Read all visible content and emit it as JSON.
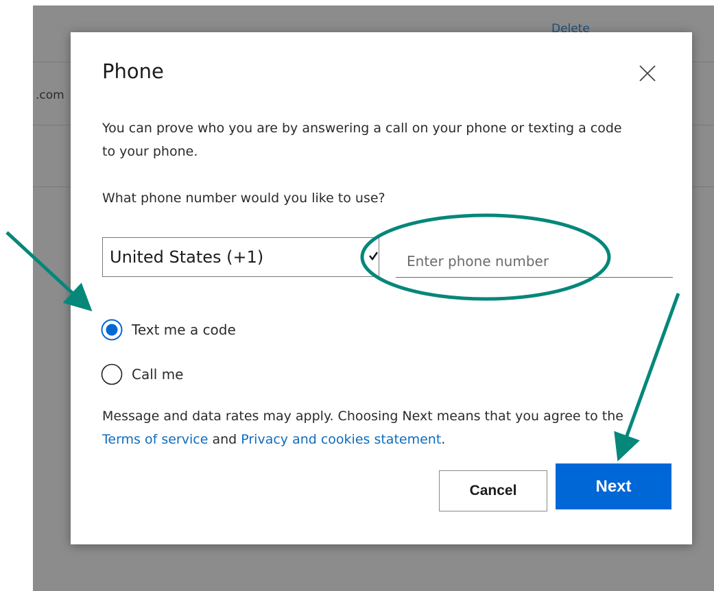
{
  "background": {
    "visible_text_fragment": ".com",
    "link_fragment": "Delete"
  },
  "dialog": {
    "title": "Phone",
    "description": "You can prove who you are by answering a call on your phone or texting a code to your phone.",
    "question": "What phone number would you like to use?",
    "country_select": {
      "selected": "United States (+1)"
    },
    "phone_input": {
      "placeholder": "Enter phone number",
      "value": ""
    },
    "method_options": [
      {
        "label": "Text me a code",
        "selected": true
      },
      {
        "label": "Call me",
        "selected": false
      }
    ],
    "notice": {
      "text_before": "Message and data rates may apply. Choosing Next means that you agree to the ",
      "terms_link": "Terms of service",
      "text_between": " and ",
      "privacy_link": "Privacy and cookies statement",
      "text_after": "."
    },
    "buttons": {
      "cancel_label": "Cancel",
      "next_label": "Next"
    }
  },
  "colors": {
    "accent_blue": "#0067d6",
    "link_blue": "#0f6cbd",
    "annotation_teal": "#05877a",
    "backdrop_gray": "#8c8c8c"
  },
  "icons": {
    "close": "close-icon",
    "select_chevron": "chevron-down-icon",
    "radio_selected": "radio-selected-icon",
    "radio_unselected": "radio-unselected-icon"
  }
}
